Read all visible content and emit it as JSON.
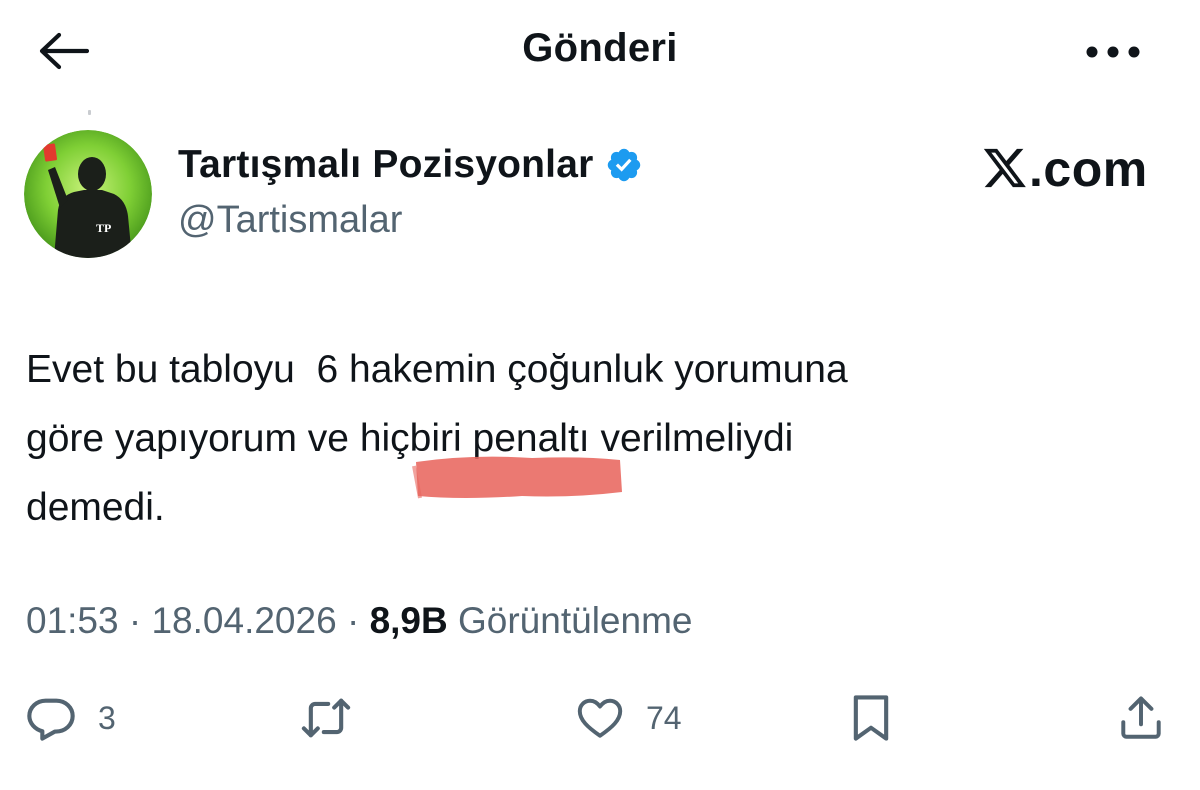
{
  "header": {
    "title": "Gönderi",
    "back_icon": "arrow-left-icon",
    "more_icon": "more-horizontal-icon"
  },
  "author": {
    "name": "Tartışmalı Pozisyonlar",
    "handle": "@Tartismalar",
    "verified": true,
    "avatar_badge": "TP",
    "avatar_color": "#5fb829"
  },
  "watermark": {
    "text": ".com",
    "logo": "x-logo-icon"
  },
  "tweet": {
    "text": "Evet bu tabloyu  6 hakemin çoğunluk yorumuna\ngöre yapıyorum ve hiçbiri penaltı verilmeliydi\ndemedi."
  },
  "meta": {
    "time": "01:53",
    "separator": "·",
    "date": "18.04.2026",
    "views_count": "8,9B",
    "views_label": "Görüntülenme"
  },
  "actions": {
    "reply_count": "3",
    "like_count": "74"
  },
  "colors": {
    "text": "#0f1419",
    "secondary": "#536471",
    "verified_blue": "#1d9bf0",
    "highlight": "#e8675f"
  }
}
